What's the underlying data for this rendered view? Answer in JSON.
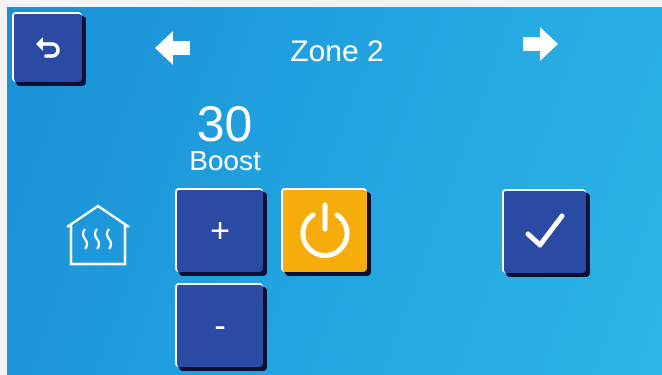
{
  "header": {
    "title": "Zone 2",
    "back_icon": "back-arrow-icon",
    "prev_icon": "left-arrow-icon",
    "next_icon": "right-arrow-icon"
  },
  "control": {
    "value": "30",
    "mode": "Boost",
    "increase_label": "+",
    "decrease_label": "-",
    "power_icon": "power-icon",
    "confirm_icon": "check-icon",
    "zone_icon": "house-heating-icon"
  },
  "colors": {
    "background_start": "#1a8fd6",
    "background_end": "#2bb6e6",
    "button": "#2a4aa3",
    "power_button": "#f6ac0a",
    "shadow": "#0b0f33",
    "text": "#ffffff"
  }
}
